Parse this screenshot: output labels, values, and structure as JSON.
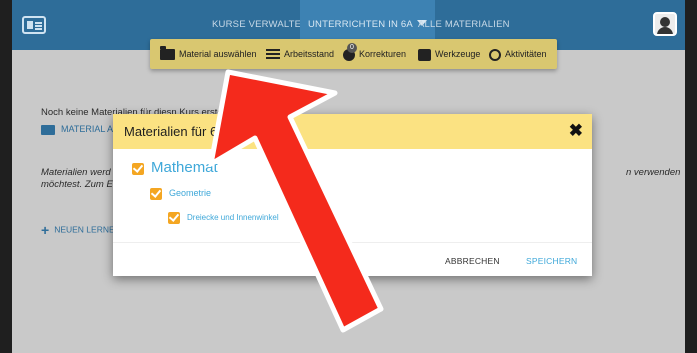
{
  "nav": {
    "kurse": "KURSE VERWALTEN",
    "unterricht": "UNTERRICHTEN IN 6A",
    "alle": "ALLE MATERIALIEN"
  },
  "submenu": {
    "material": "Material auswählen",
    "arbeitsstand": "Arbeitsstand",
    "korrekturen_badge": "0",
    "korrekturen": "Korrekturen",
    "werkzeuge": "Werkzeuge",
    "aktivitaeten": "Aktivitäten"
  },
  "content": {
    "no_materials": "Noch keine Materialien für diesn Kurs erste",
    "material_button": "MATERIAL AU",
    "info_line1": "Materialien werd",
    "info_line2": "möchtest. Zum E",
    "info_right": "n verwenden",
    "new_button": "NEUEN LERNE"
  },
  "modal": {
    "title": "Materialien für 6a",
    "close": "✖",
    "tree": {
      "level1": "Mathemat",
      "level2": "Geometrie",
      "level3": "Dreiecke und Innenwinkel"
    },
    "cancel": "ABBRECHEN",
    "save": "SPEICHERN"
  },
  "colors": {
    "topbar": "#2e6d99",
    "submenu": "#d9c770",
    "modal_header": "#fbe282",
    "checkbox": "#f4a622",
    "link": "#3fa8d9",
    "arrow": "#f42a1c"
  }
}
